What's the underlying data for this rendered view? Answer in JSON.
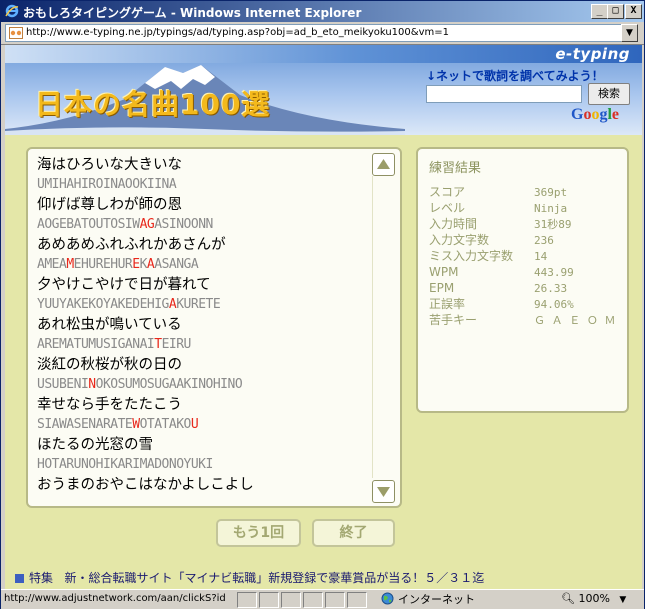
{
  "window": {
    "title": "おもしろタイピングゲーム - Windows Internet Explorer",
    "minimize": "_",
    "maximize": "□",
    "close": "X"
  },
  "address": {
    "url": "http://www.e-typing.ne.jp/typings/ad/typing.asp?obj=ad_b_eto_meikyoku100&vm=1",
    "dropdown": "▼"
  },
  "banner": {
    "brand": "e-typing",
    "title": "日本の名曲100選",
    "lyrics_link": "↓ネットで歌詞を調べてみよう！",
    "search_button": "検索",
    "search_value": "",
    "google": [
      "G",
      "o",
      "o",
      "g",
      "l",
      "e"
    ],
    "google_colors": [
      "#1f57c8",
      "#d93025",
      "#f0b400",
      "#1f57c8",
      "#1e9a3e",
      "#d93025"
    ]
  },
  "lyrics": [
    {
      "jp": "海はひろいな大きいな",
      "ro": [
        [
          "UMIHAHIROINAOOKIINA",
          false
        ]
      ]
    },
    {
      "jp": "仰げば尊しわが師の恩",
      "ro": [
        [
          "AOGEBATOUTOSIW",
          false
        ],
        [
          "AG",
          true
        ],
        [
          "ASINOONN",
          false
        ]
      ]
    },
    {
      "jp": "あめあめふれふれかあさんが",
      "ro": [
        [
          "AMEA",
          false
        ],
        [
          "M",
          true
        ],
        [
          "EHUREHUR",
          false
        ],
        [
          "E",
          true
        ],
        [
          "K",
          false
        ],
        [
          "A",
          true
        ],
        [
          "ASANGA",
          false
        ]
      ]
    },
    {
      "jp": "夕やけこやけで日が暮れて",
      "ro": [
        [
          "YUUYAKEKOYAKEDEHIG",
          false
        ],
        [
          "A",
          true
        ],
        [
          "KURETE",
          false
        ]
      ]
    },
    {
      "jp": "あれ松虫が鳴いている",
      "ro": [
        [
          "AREMATUMUSIGANAI",
          false
        ],
        [
          "T",
          true
        ],
        [
          "EIRU",
          false
        ]
      ]
    },
    {
      "jp": "淡紅の秋桜が秋の日の",
      "ro": [
        [
          "USUBENI",
          false
        ],
        [
          "N",
          true
        ],
        [
          "OKOSUMOSUGAAKINOHINO",
          false
        ]
      ]
    },
    {
      "jp": "幸せなら手をたたこう",
      "ro": [
        [
          "SIAWASENARATE",
          false
        ],
        [
          "W",
          true
        ],
        [
          "OTATAKO",
          false
        ],
        [
          "U",
          true
        ]
      ]
    },
    {
      "jp": "ほたるの光窓の雪",
      "ro": [
        [
          "HOTARUNOHIKARIMADONOYUKI",
          false
        ]
      ]
    },
    {
      "jp": "おうまのおやこはなかよしこよし",
      "ro": []
    }
  ],
  "results": {
    "title": "練習結果",
    "rows": [
      {
        "label": "スコア",
        "value": "369pt"
      },
      {
        "label": "レベル",
        "value": "Ninja"
      },
      {
        "label": "入力時間",
        "value": "31秒89"
      },
      {
        "label": "入力文字数",
        "value": "236"
      },
      {
        "label": "ミス入力文字数",
        "value": "14"
      },
      {
        "label": "WPM",
        "value": "443.99"
      },
      {
        "label": "EPM",
        "value": "26.33"
      },
      {
        "label": "正誤率",
        "value": "94.06%"
      },
      {
        "label": "苦手キー",
        "value": "Ｇ Ａ Ｅ Ｏ Ｍ"
      }
    ]
  },
  "buttons": {
    "retry": "もう1回",
    "end": "終了"
  },
  "news": {
    "label": "特集",
    "text": "新・総合転職サイト「マイナビ転職」新規登録で豪華賞品が当る！５／３１迄"
  },
  "status": {
    "url": "http://www.adjustnetwork.com/aan/clickS?id",
    "zone": "インターネット",
    "zoom": "100%"
  }
}
